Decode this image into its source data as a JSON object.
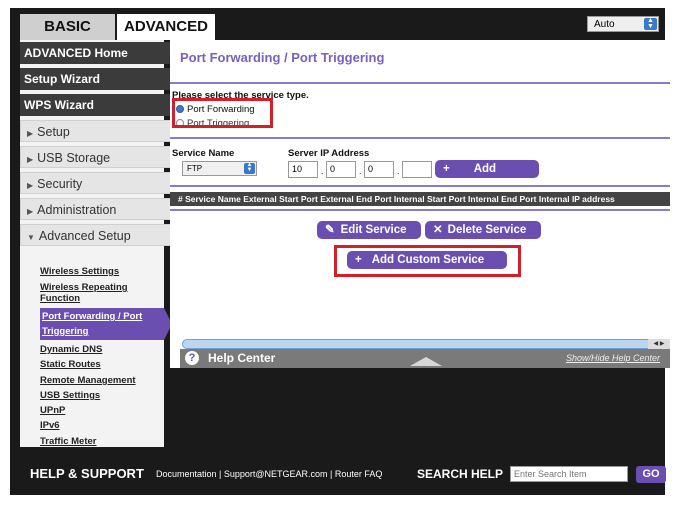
{
  "top_tabs": {
    "basic": "BASIC",
    "advanced": "ADVANCED"
  },
  "auto_select": {
    "value": "Auto"
  },
  "left_nav": {
    "dark_items": [
      "ADVANCED Home",
      "Setup Wizard",
      "WPS Wizard"
    ],
    "light_items": [
      "Setup",
      "USB Storage",
      "Security",
      "Administration",
      "Advanced Setup"
    ],
    "sub_items": {
      "wireless_settings": "Wireless Settings",
      "wireless_repeating_1": "Wireless Repeating",
      "wireless_repeating_2": "Function",
      "port_forwarding_1": "Port Forwarding / Port",
      "port_forwarding_2": "Triggering",
      "dynamic_dns": "Dynamic DNS",
      "static_routes": "Static Routes",
      "remote_management": "Remote Management",
      "usb_settings": "USB Settings",
      "upnp": "UPnP",
      "ipv6": "IPv6",
      "traffic_meter": "Traffic Meter"
    }
  },
  "content": {
    "title": "Port Forwarding / Port Triggering",
    "service_type_label": "Please select the service type.",
    "radio_port_forwarding": "Port Forwarding",
    "radio_port_triggering": "Port Triggering",
    "service_name_label": "Service Name",
    "server_ip_label": "Server IP Address",
    "service_name_value": "FTP",
    "ip": [
      "10",
      "0",
      "0",
      ""
    ],
    "add_button": "Add",
    "table_header": "# Service Name External Start Port External End Port Internal Start Port Internal End Port Internal IP address",
    "edit_service": "Edit Service",
    "delete_service": "Delete Service",
    "add_custom_service": "Add Custom Service"
  },
  "help": {
    "title": "Help Center",
    "show_hide": "Show/Hide Help Center"
  },
  "footer": {
    "help_support": "HELP & SUPPORT",
    "links": "Documentation | Support@NETGEAR.com | Router FAQ",
    "search_help": "SEARCH HELP",
    "search_placeholder": "Enter Search Item",
    "go": "GO"
  }
}
